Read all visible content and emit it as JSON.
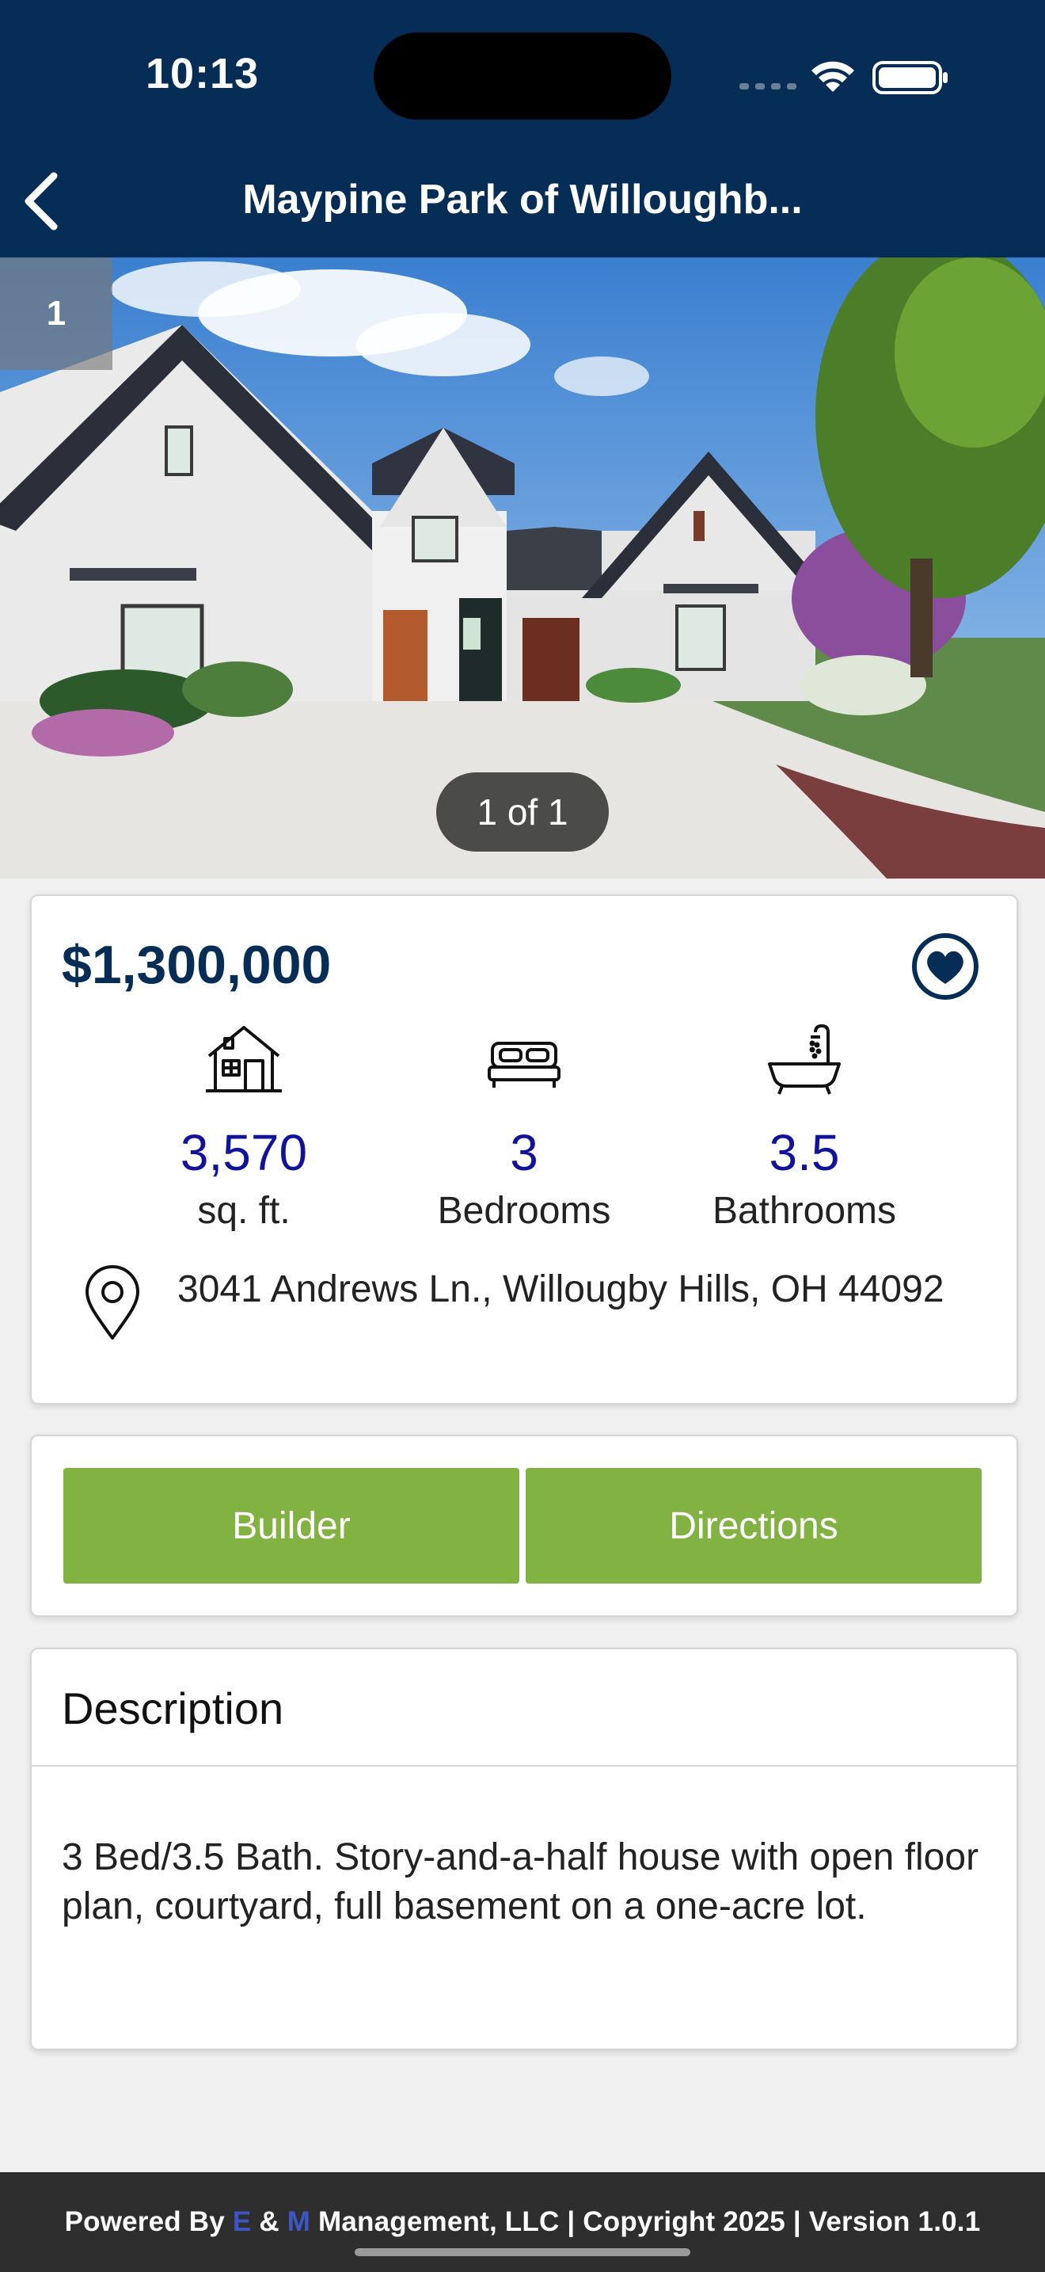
{
  "status_bar": {
    "time": "10:13"
  },
  "nav": {
    "title": "Maypine Park of Willoughb..."
  },
  "gallery": {
    "index": "1",
    "counter": "1 of 1"
  },
  "listing": {
    "price": "$1,300,000",
    "stats": [
      {
        "icon": "house-icon",
        "value": "3,570",
        "label": "sq. ft."
      },
      {
        "icon": "bed-icon",
        "value": "3",
        "label": "Bedrooms"
      },
      {
        "icon": "bathtub-icon",
        "value": "3.5",
        "label": "Bathrooms"
      }
    ],
    "address": "3041 Andrews Ln., Willougby Hills, OH 44092"
  },
  "actions": {
    "builder": "Builder",
    "directions": "Directions"
  },
  "description": {
    "title": "Description",
    "text": "3 Bed/3.5 Bath. Story-and-a-half house with open floor plan, courtyard, full basement on a one-acre lot."
  },
  "footer": {
    "powered_by": "Powered By ",
    "e": "E",
    "amp": " & ",
    "m": "M",
    "rest": " Management, LLC | Copyright 2025 | Version 1.0.1"
  },
  "colors": {
    "header": "#052d55",
    "button_green": "#82b342",
    "stat_value": "#11149a",
    "footer": "#2e2e2e"
  }
}
